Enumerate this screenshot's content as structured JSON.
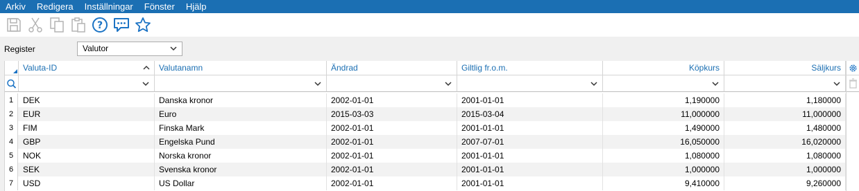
{
  "menu": [
    "Arkiv",
    "Redigera",
    "Inställningar",
    "Fönster",
    "Hjälp"
  ],
  "toolbar": {
    "icons": [
      "save-icon",
      "cut-icon",
      "copy-icon",
      "paste-icon",
      "help-icon",
      "chat-icon",
      "favorite-star-icon"
    ]
  },
  "register": {
    "label": "Register",
    "selected": "Valutor"
  },
  "grid": {
    "columns": [
      "Valuta-ID",
      "Valutanamn",
      "Ändrad",
      "Giltlig fr.o.m.",
      "Köpkurs",
      "Säljkurs"
    ],
    "sort_column": "Valuta-ID",
    "rows": [
      {
        "n": "1",
        "id": "DEK",
        "name": "Danska kronor",
        "changed": "2002-01-01",
        "valid_from": "2001-01-01",
        "buy": "1,190000",
        "sell": "1,180000"
      },
      {
        "n": "2",
        "id": "EUR",
        "name": "Euro",
        "changed": "2015-03-03",
        "valid_from": "2015-03-04",
        "buy": "11,000000",
        "sell": "11,000000"
      },
      {
        "n": "3",
        "id": "FIM",
        "name": "Finska Mark",
        "changed": "2002-01-01",
        "valid_from": "2001-01-01",
        "buy": "1,490000",
        "sell": "1,480000"
      },
      {
        "n": "4",
        "id": "GBP",
        "name": "Engelska Pund",
        "changed": "2002-01-01",
        "valid_from": "2007-07-01",
        "buy": "16,050000",
        "sell": "16,020000"
      },
      {
        "n": "5",
        "id": "NOK",
        "name": "Norska kronor",
        "changed": "2002-01-01",
        "valid_from": "2001-01-01",
        "buy": "1,080000",
        "sell": "1,080000"
      },
      {
        "n": "6",
        "id": "SEK",
        "name": "Svenska kronor",
        "changed": "2002-01-01",
        "valid_from": "2001-01-01",
        "buy": "1,000000",
        "sell": "1,000000"
      },
      {
        "n": "7",
        "id": "USD",
        "name": "US Dollar",
        "changed": "2002-01-01",
        "valid_from": "2001-01-01",
        "buy": "9,410000",
        "sell": "9,260000"
      }
    ]
  },
  "colors": {
    "menubar": "#1b6fb3",
    "header_text": "#1b6fb3",
    "icon_blue": "#1b73c4",
    "disabled_icon": "#b4b4b4"
  }
}
